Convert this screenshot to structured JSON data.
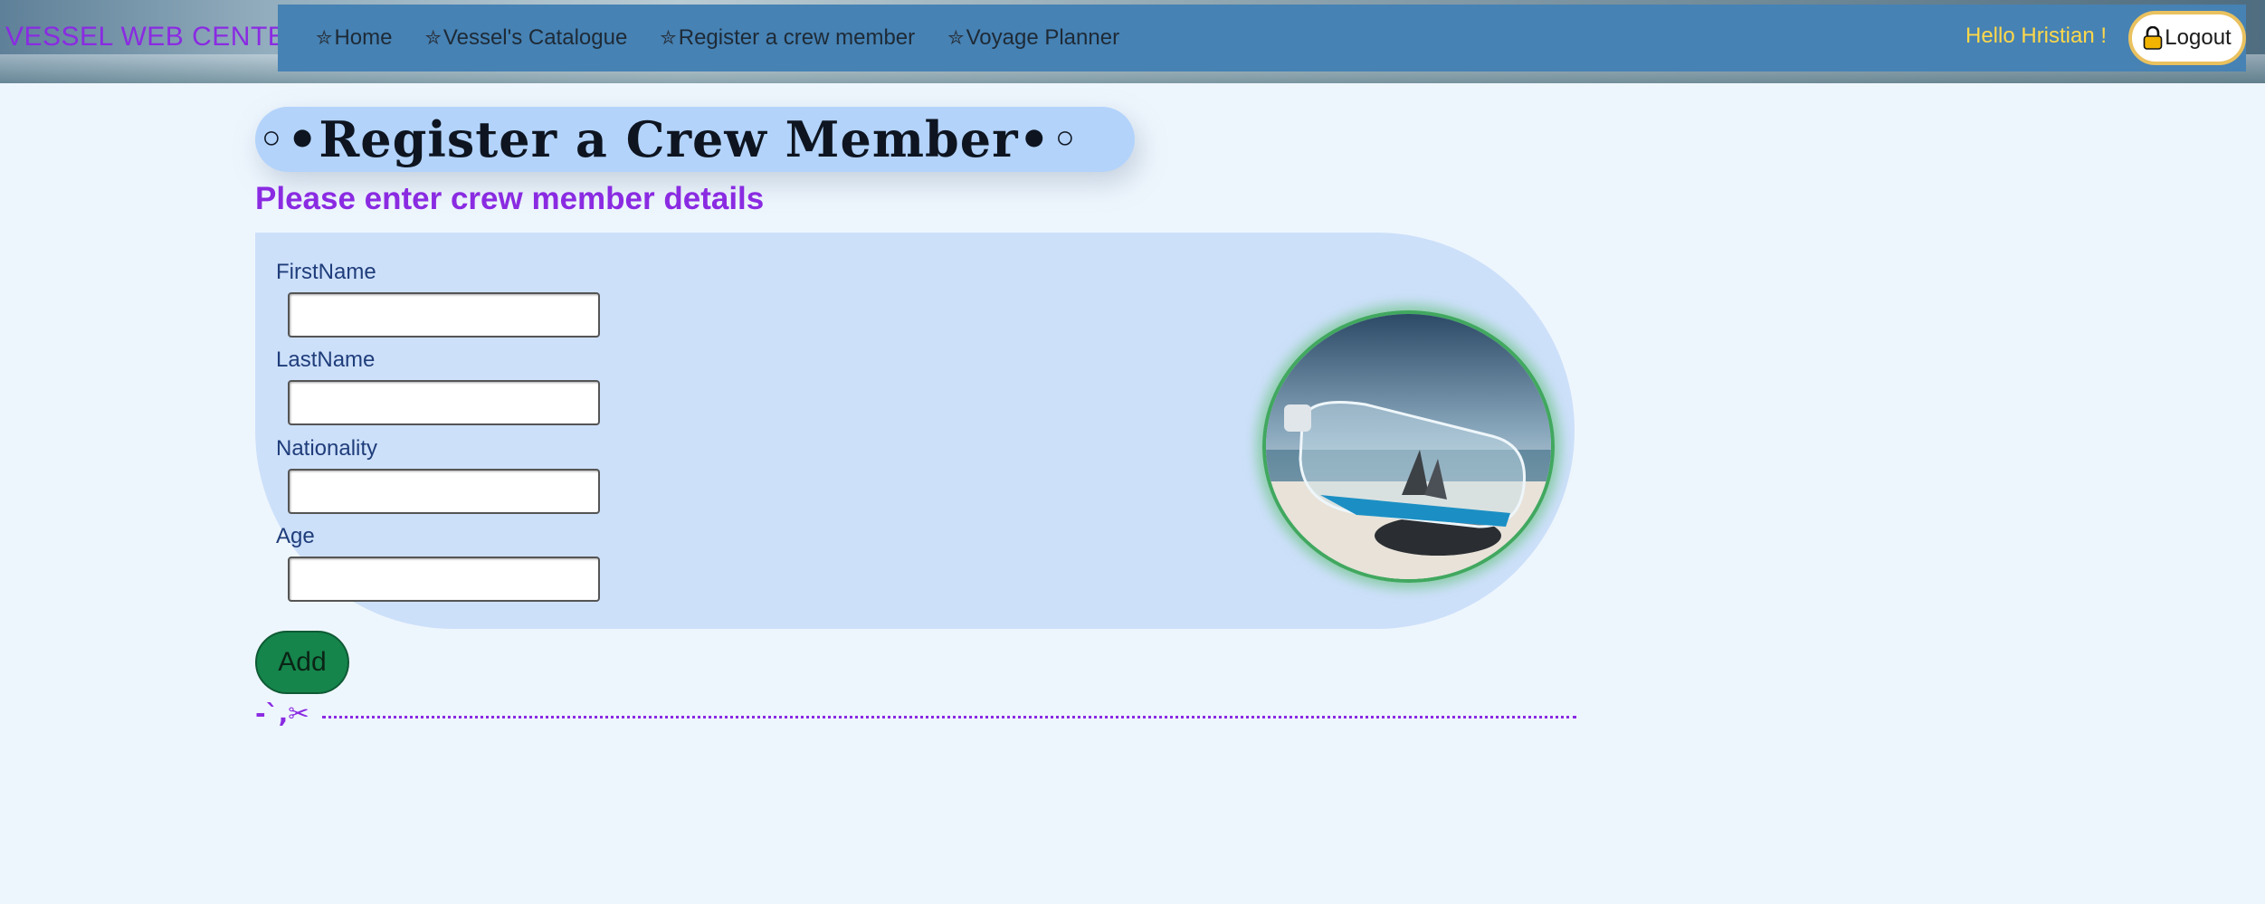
{
  "header": {
    "brand": "VESSEL WEB CENTER",
    "nav": [
      {
        "icon": "star-icon",
        "label": "Home"
      },
      {
        "icon": "star-icon",
        "label": "Vessel's Catalogue"
      },
      {
        "icon": "star-icon",
        "label": "Register a crew member"
      },
      {
        "icon": "star-icon",
        "label": "Voyage Planner"
      }
    ],
    "greeting": "Hello Hristian !",
    "logout_label": "Logout",
    "logout_icon": "lock-icon"
  },
  "page": {
    "title": "◦•Register a Crew Member•◦",
    "subtitle": "Please enter crew member details"
  },
  "form": {
    "fields": [
      {
        "label": "FirstName",
        "value": ""
      },
      {
        "label": "LastName",
        "value": ""
      },
      {
        "label": "Nationality",
        "value": ""
      },
      {
        "label": "Age",
        "value": ""
      }
    ],
    "submit_label": "Add"
  },
  "decor": {
    "cut_marks": "-`,✂",
    "image": "ship-in-bottle-photo"
  },
  "colors": {
    "brand": "#8a2be2",
    "navbar": "#4682b4",
    "greeting": "#ffd84a",
    "add_button": "#15854b",
    "panel": "#cde0fa",
    "title_pill": "#b3d3fb"
  }
}
